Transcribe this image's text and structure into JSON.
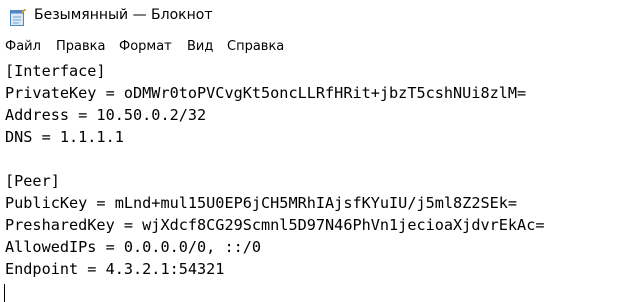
{
  "window": {
    "title": "Безымянный — Блокнот",
    "icon": "notepad-icon"
  },
  "menu": {
    "items": [
      {
        "label": "Файл"
      },
      {
        "label": "Правка"
      },
      {
        "label": "Формат"
      },
      {
        "label": "Вид"
      },
      {
        "label": "Справка"
      }
    ]
  },
  "editor": {
    "lines": [
      "[Interface]",
      "PrivateKey = oDMWr0toPVCvgKt5oncLLRfHRit+jbzT5cshNUi8zlM=",
      "Address = 10.50.0.2/32",
      "DNS = 1.1.1.1",
      "",
      "[Peer]",
      "PublicKey = mLnd+mul15U0EP6jCH5MRhIAjsfKYuIU/j5ml8Z2SEk=",
      "PresharedKey = wjXdcf8CG29Scmnl5D97N46PhVn1jecioaXjdvrEkAc=",
      "AllowedIPs = 0.0.0.0/0, ::/0",
      "Endpoint = 4.3.2.1:54321"
    ]
  }
}
